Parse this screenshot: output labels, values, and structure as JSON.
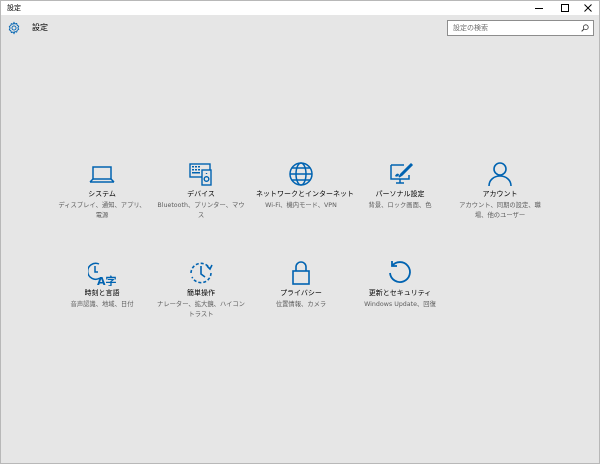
{
  "window": {
    "title": "設定"
  },
  "header": {
    "title": "設定"
  },
  "search": {
    "placeholder": "設定の検索"
  },
  "accent_color": "#0063b1",
  "tiles": [
    {
      "label": "システム",
      "desc": "ディスプレイ、通知、アプリ、電源",
      "icon": "laptop-icon"
    },
    {
      "label": "デバイス",
      "desc": "Bluetooth、プリンター、マウス",
      "icon": "devices-icon"
    },
    {
      "label": "ネットワークとインターネット",
      "desc": "Wi-Fi、機内モード、VPN",
      "icon": "globe-icon"
    },
    {
      "label": "パーソナル設定",
      "desc": "背景、ロック画面、色",
      "icon": "personalization-icon"
    },
    {
      "label": "アカウント",
      "desc": "アカウント、同期の設定、職場、他のユーザー",
      "icon": "person-icon"
    },
    {
      "label": "時刻と言語",
      "desc": "音声認識、地域、日付",
      "icon": "time-language-icon"
    },
    {
      "label": "簡単操作",
      "desc": "ナレーター、拡大鏡、ハイコントラスト",
      "icon": "ease-of-access-icon"
    },
    {
      "label": "プライバシー",
      "desc": "位置情報、カメラ",
      "icon": "lock-icon"
    },
    {
      "label": "更新とセキュリティ",
      "desc": "Windows Update、回復",
      "icon": "update-icon"
    }
  ]
}
